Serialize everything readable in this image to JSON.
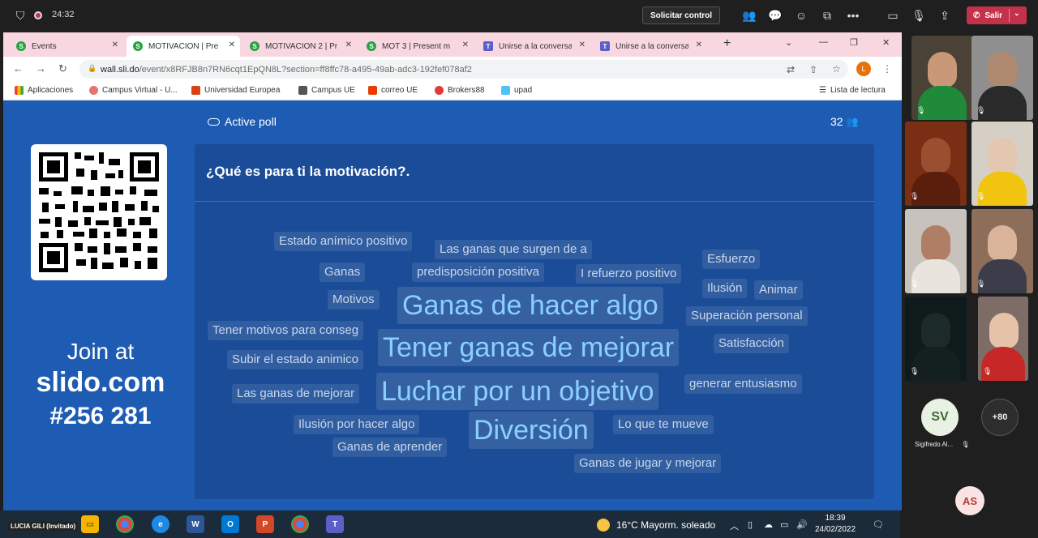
{
  "call_bar": {
    "timer": "24:32",
    "request_control": "Solicitar control",
    "leave_label": "Salir"
  },
  "browser": {
    "tabs": [
      {
        "label": "Events",
        "icon": "slido-icon"
      },
      {
        "label": "MOTIVACION | Pre",
        "icon": "slido-icon"
      },
      {
        "label": "MOTIVACION 2 | Pr",
        "icon": "slido-icon"
      },
      {
        "label": "MOT 3 | Present m",
        "icon": "slido-icon"
      },
      {
        "label": "Unirse a la conversa",
        "icon": "teams-icon"
      },
      {
        "label": "Unirse a la conversa",
        "icon": "teams-icon"
      }
    ],
    "url_host": "wall.sli.do",
    "url_rest": "/event/x8RFJB8n7RN6cqt1EpQN8L?section=ff8ffc78-a495-49ab-adc3-192fef078af2",
    "profile_initial": "L",
    "bookmarks": [
      {
        "label": "Aplicaciones"
      },
      {
        "label": "Campus Virtual - U..."
      },
      {
        "label": "Universidad Europea"
      },
      {
        "label": "Campus UE"
      },
      {
        "label": "correo UE"
      },
      {
        "label": "Brokers88"
      },
      {
        "label": "upad"
      }
    ],
    "reading_list": "Lista de lectura"
  },
  "slido": {
    "active_poll": "Active poll",
    "participant_count": "32",
    "join_line1": "Join at",
    "join_site": "slido.com",
    "join_code": "#256 281",
    "question": "¿Qué es para ti la motivación?.",
    "words": [
      {
        "text": "Estado anímico positivo",
        "size": "small"
      },
      {
        "text": "Las ganas que surgen de a",
        "size": "small"
      },
      {
        "text": "Esfuerzo",
        "size": "small"
      },
      {
        "text": "Ganas",
        "size": "small"
      },
      {
        "text": "predisposición positiva",
        "size": "small"
      },
      {
        "text": "I refuerzo positivo",
        "size": "small"
      },
      {
        "text": "Ilusión",
        "size": "small"
      },
      {
        "text": "Animar",
        "size": "small"
      },
      {
        "text": "Motivos",
        "size": "small"
      },
      {
        "text": "Ganas de hacer algo",
        "size": "large"
      },
      {
        "text": "Superación personal",
        "size": "small"
      },
      {
        "text": "Tener motivos para conseg",
        "size": "small"
      },
      {
        "text": "Satisfacción",
        "size": "small"
      },
      {
        "text": "Tener ganas de mejorar",
        "size": "large"
      },
      {
        "text": "Subir el estado animico",
        "size": "small"
      },
      {
        "text": "generar entusiasmo",
        "size": "small"
      },
      {
        "text": "Las ganas de mejorar",
        "size": "small"
      },
      {
        "text": "Luchar por un objetivo",
        "size": "large"
      },
      {
        "text": "Ilusión por hacer algo",
        "size": "small"
      },
      {
        "text": "Lo que te mueve",
        "size": "small"
      },
      {
        "text": "Diversión",
        "size": "large"
      },
      {
        "text": "Ganas de aprender",
        "size": "small"
      },
      {
        "text": "Ganas de jugar y mejorar",
        "size": "small"
      }
    ]
  },
  "participants": {
    "avatar_sv": "SV",
    "overflow": "+80",
    "sv_name": "Sigifredo Al...",
    "avatar_as": "AS"
  },
  "taskbar": {
    "presenter_label": "LUCIA GILI (Invitado)",
    "weather": "16°C  Mayorm. soleado",
    "time": "18:39",
    "date": "24/02/2022"
  }
}
